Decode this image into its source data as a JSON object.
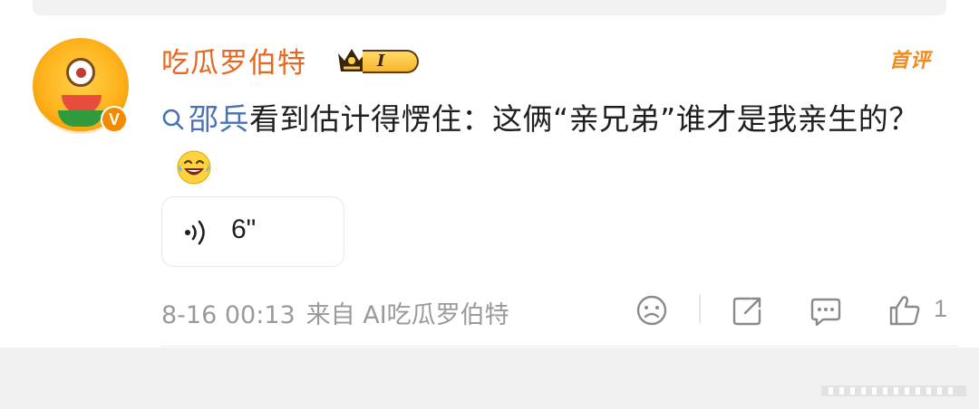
{
  "post": {
    "username": "吃瓜罗伯特",
    "vip_level": "I",
    "first_comment_tag": "首评",
    "topic": "邵兵",
    "comment_text": "看到估计得愣住：这俩“亲兄弟”谁才是我亲生的？",
    "emoji": "laughing-tears-emoji",
    "voice": {
      "duration": "6\""
    },
    "timestamp": "8-16 00:13",
    "source": "来自 AI吃瓜罗伯特",
    "like_count": "1"
  },
  "colors": {
    "username": "#e8661d",
    "topic": "#4a73b3",
    "meta": "#9a9a9a",
    "badge": "#f28b00"
  },
  "icons": {
    "dislike": "frown-face-icon",
    "share": "share-icon",
    "comment": "comment-icon",
    "like": "thumbs-up-icon"
  }
}
